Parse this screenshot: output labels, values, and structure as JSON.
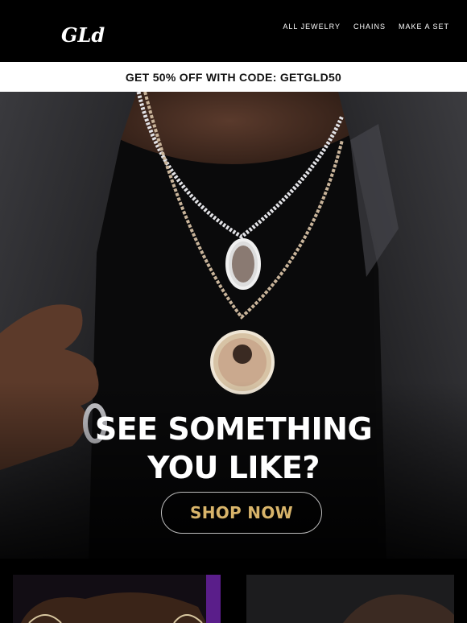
{
  "header": {
    "logo_text": "GLd",
    "nav": [
      {
        "label": "ALL JEWELRY"
      },
      {
        "label": "CHAINS"
      },
      {
        "label": "MAKE A SET"
      }
    ]
  },
  "promo": {
    "text": "GET 50% OFF WITH CODE: GETGLD50"
  },
  "hero": {
    "headline_line1": "SEE SOMETHING",
    "headline_line2": "YOU LIKE?",
    "cta_label": "SHOP NOW",
    "cta_color": "#d8b46a"
  },
  "colors": {
    "background": "#000000",
    "promo_bg": "#ffffff",
    "promo_text": "#111111"
  },
  "icons": {
    "logo": "gld-logo"
  }
}
